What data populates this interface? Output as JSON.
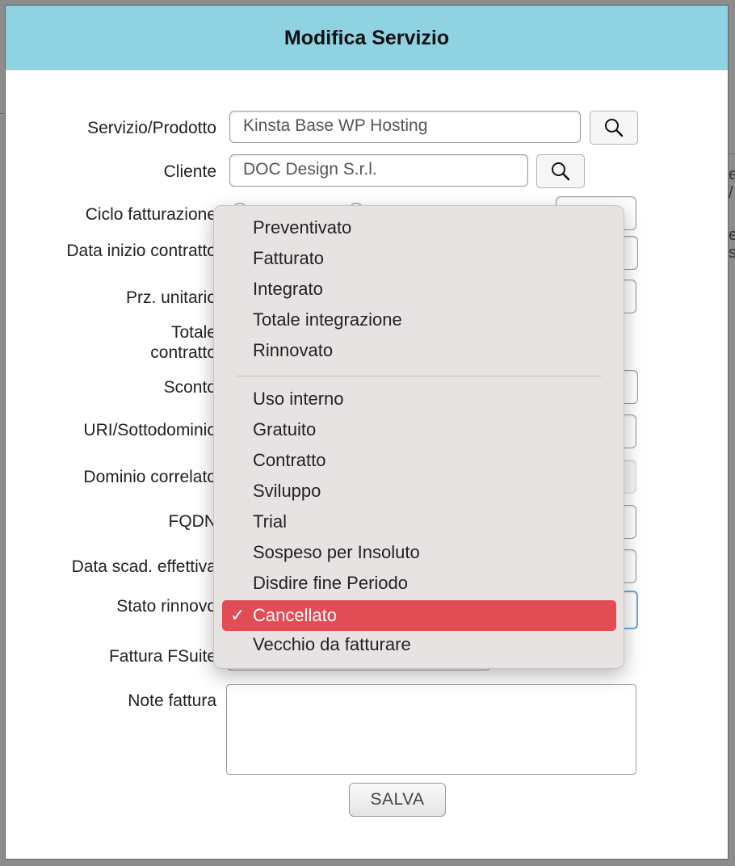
{
  "dialog": {
    "title": "Modifica Servizio",
    "save_label": "SALVA"
  },
  "form": {
    "servizio_label": "Servizio/Prodotto",
    "servizio_value": "Kinsta Base  WP Hosting",
    "cliente_label": "Cliente",
    "cliente_value": "DOC Design S.r.l.",
    "ciclo_label": "Ciclo fatturazione",
    "data_inizio_label": "Data inizio contratto",
    "prezzo_label": "Prz. unitario",
    "totale_label_1": "Totale",
    "totale_label_2": "contratto",
    "sconto_label": "Sconto",
    "uri_label": "URI/Sottodominio",
    "dominio_label": "Dominio correlato",
    "fqdn_label": "FQDN",
    "data_scad_label": "Data scad. effettiva",
    "stato_label": "Stato rinnovo",
    "fattura_label": "Fattura FSuite",
    "note_label": "Note fattura"
  },
  "stato_menu": {
    "group1": [
      "Preventivato",
      "Fatturato",
      "Integrato",
      "Totale integrazione",
      "Rinnovato"
    ],
    "group2": [
      "Uso interno",
      "Gratuito",
      "Contratto",
      "Sviluppo",
      "Trial",
      "Sospeso per Insoluto",
      "Disdire fine Periodo",
      "Cancellato",
      "Vecchio da fatturare"
    ],
    "selected": "Cancellato",
    "check_glyph": "✓"
  },
  "background": {
    "frag1": "e",
    "frag2": "/",
    "frag3": "e",
    "frag4": "s/"
  },
  "colors": {
    "header": "#8fd3e3",
    "selected_item": "#e24c55",
    "menu_bg": "#e8e3e3"
  }
}
